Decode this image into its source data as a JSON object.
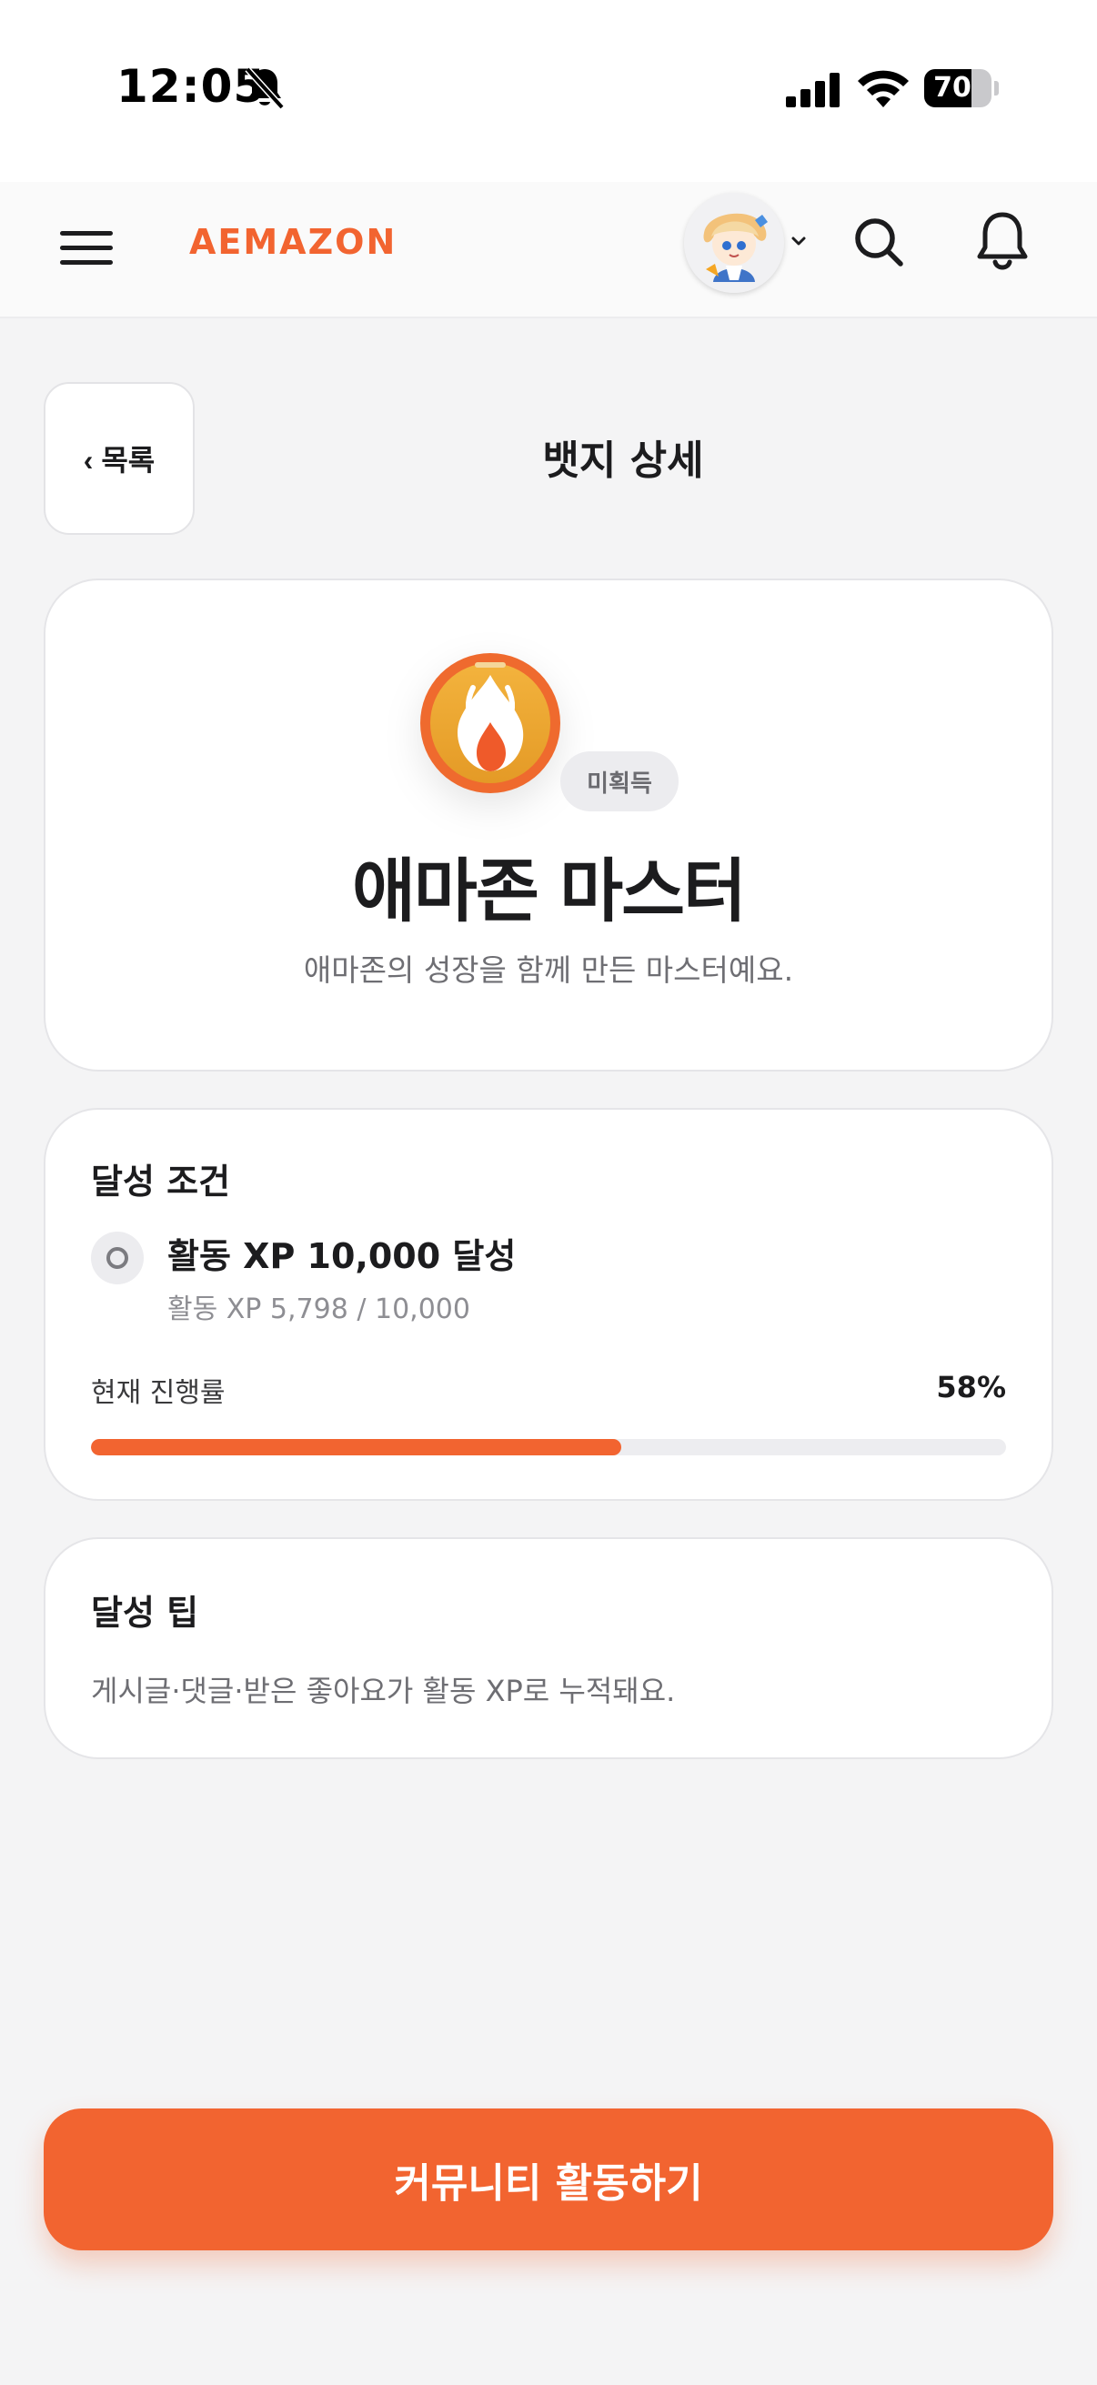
{
  "status_bar": {
    "time": "12:05",
    "battery_level": "70",
    "battery_fraction": 0.7
  },
  "header": {
    "brand": "AEMAZON",
    "icons": [
      "menu-icon",
      "avatar",
      "chevron-down-icon",
      "search-icon",
      "bell-icon"
    ]
  },
  "nav": {
    "back_label": "‹ 목록",
    "title": "뱃지 상세"
  },
  "badge": {
    "status": "미획득",
    "name": "애마존 마스터",
    "description": "애마존의 성장을 함께 만든 마스터예요.",
    "emblem_icon": "flame-icon"
  },
  "conditions": {
    "title": "달성 조건",
    "item_title": "활동 XP 10,000 달성",
    "item_progress": "활동 XP 5,798 / 10,000",
    "progress_label": "현재 진행률",
    "progress_percent": "58%",
    "progress_fraction": 0.58
  },
  "tip": {
    "title": "달성 팁",
    "text": "게시글·댓글·받은 좋아요가 활동 XP로 누적돼요."
  },
  "cta": {
    "label": "커뮤니티 활동하기"
  },
  "colors": {
    "accent": "#f26430",
    "background": "#f4f4f5",
    "card": "#ffffff"
  }
}
